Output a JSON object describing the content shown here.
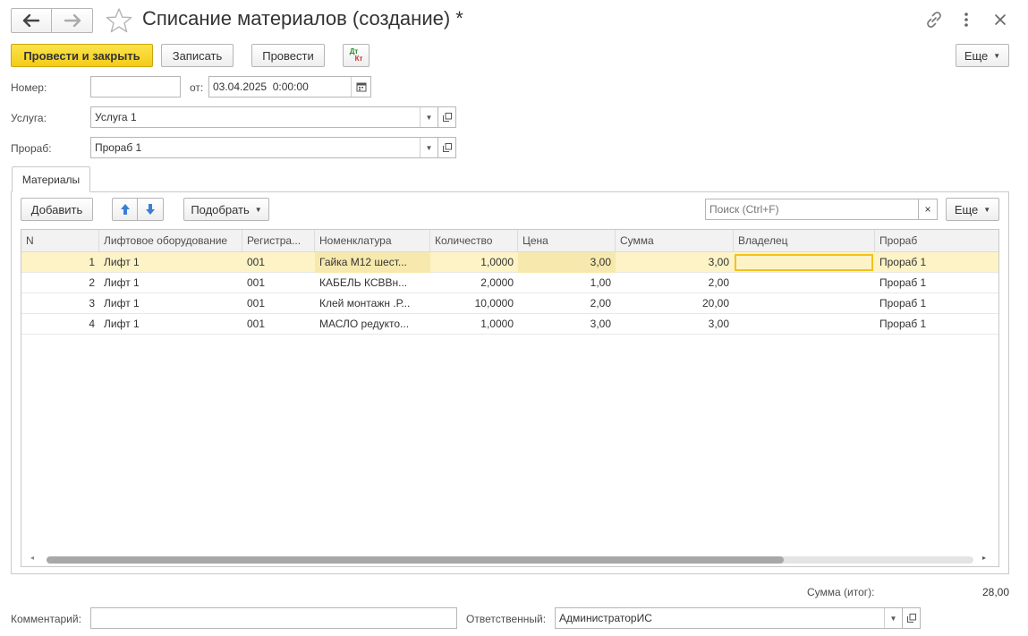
{
  "window": {
    "title": "Списание материалов (создание) *"
  },
  "toolbar": {
    "post_close": "Провести и закрыть",
    "save": "Записать",
    "post": "Провести",
    "dtkt_top": "Дт",
    "dtkt_bottom": "Кт",
    "more": "Еще"
  },
  "form": {
    "number_label": "Номер:",
    "number_value": "",
    "date_label": "от:",
    "date_value": "03.04.2025  0:00:00",
    "service_label": "Услуга:",
    "service_value": "Услуга 1",
    "foreman_label": "Прораб:",
    "foreman_value": "Прораб 1"
  },
  "tabs": [
    {
      "label": "Материалы"
    }
  ],
  "materials": {
    "add": "Добавить",
    "pick": "Подобрать",
    "search_placeholder": "Поиск (Ctrl+F)",
    "search_clear": "×",
    "more": "Еще",
    "columns": [
      "N",
      "Лифтовое оборудование",
      "Регистра...",
      "Номенклатура",
      "Количество",
      "Цена",
      "Сумма",
      "Владелец",
      "Прораб"
    ],
    "rows": [
      {
        "n": "1",
        "equipment": "Лифт 1",
        "reg": "001",
        "nomenclature": "Гайка  М12 шест...",
        "qty": "1,0000",
        "price": "3,00",
        "sum": "3,00",
        "owner": "",
        "foreman": "Прораб 1"
      },
      {
        "n": "2",
        "equipment": "Лифт 1",
        "reg": "001",
        "nomenclature": "КАБЕЛЬ  КСВВн...",
        "qty": "2,0000",
        "price": "1,00",
        "sum": "2,00",
        "owner": "",
        "foreman": "Прораб 1"
      },
      {
        "n": "3",
        "equipment": "Лифт 1",
        "reg": "001",
        "nomenclature": "Клей монтажн .Р...",
        "qty": "10,0000",
        "price": "2,00",
        "sum": "20,00",
        "owner": "",
        "foreman": "Прораб 1"
      },
      {
        "n": "4",
        "equipment": "Лифт 1",
        "reg": "001",
        "nomenclature": "МАСЛО  редукто...",
        "qty": "1,0000",
        "price": "3,00",
        "sum": "3,00",
        "owner": "",
        "foreman": "Прораб 1"
      }
    ],
    "selected_row": 0
  },
  "footer": {
    "total_label": "Сумма (итог):",
    "total_value": "28,00",
    "comment_label": "Комментарий:",
    "comment_value": "",
    "responsible_label": "Ответственный:",
    "responsible_value": "АдминистраторИС"
  },
  "colors": {
    "primary": "#f4cc18",
    "selected_row": "#fdf3c7",
    "focus": "#f2c21a"
  }
}
